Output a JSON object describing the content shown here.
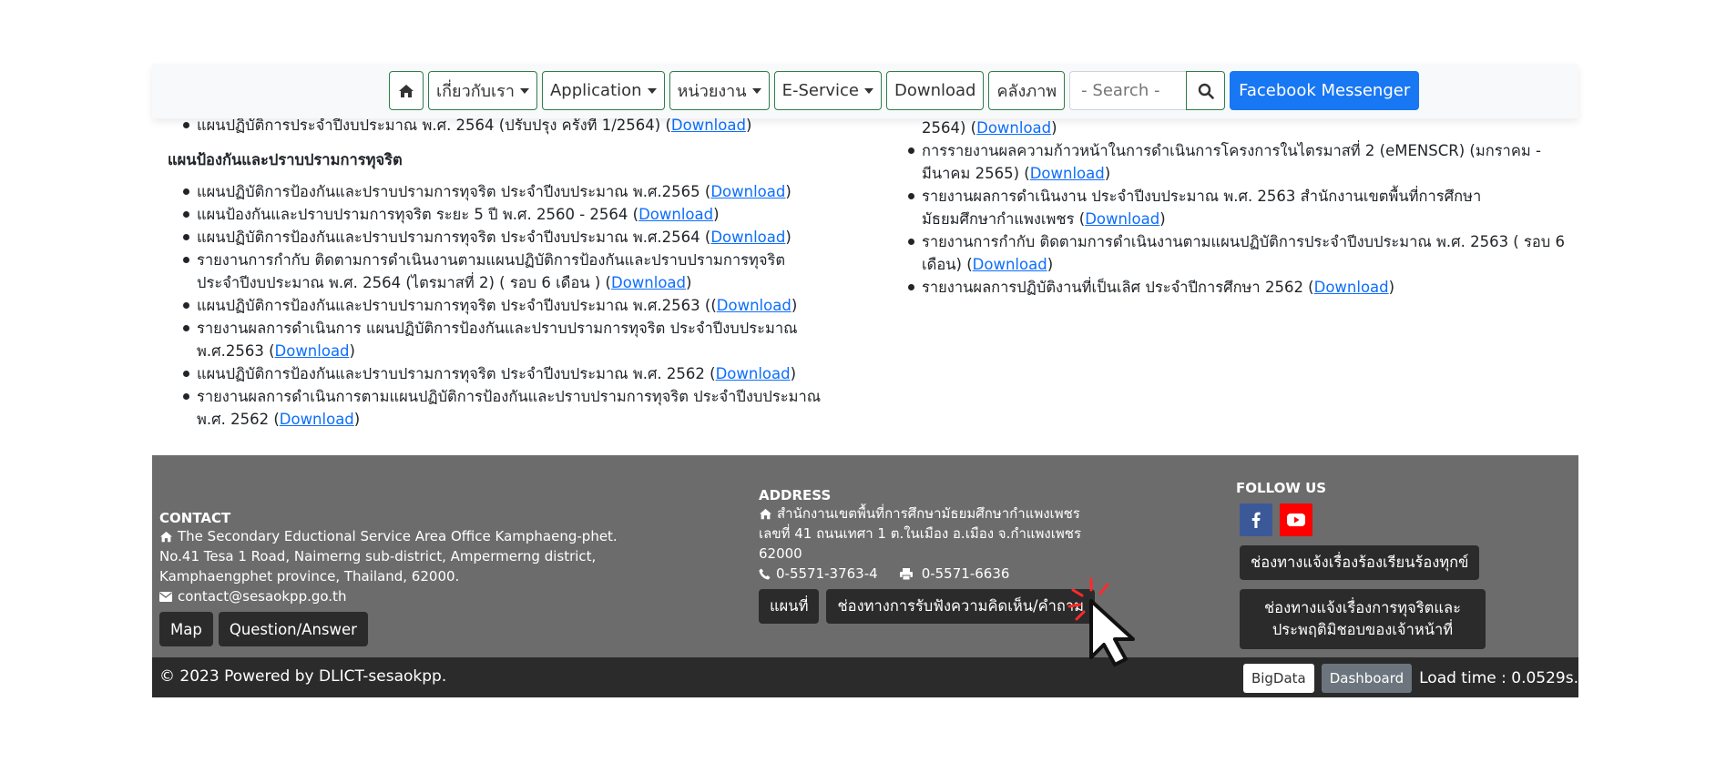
{
  "nav": {
    "about": "เกี่ยวกับเรา",
    "application": "Application",
    "units": "หน่วยงาน",
    "eservice": "E-Service",
    "download": "Download",
    "gallery": "คลังภาพ",
    "search_placeholder": "- Search -",
    "facebook_messenger": "Facebook Messenger"
  },
  "left": {
    "top_item": {
      "text": "แผนปฏิบัติการประจำปีงบประมาณ พ.ศ. 2564 (ปรับปรุง ครั้งที่ 1/2564) (",
      "link": "Download",
      "tail": ")"
    },
    "section_title": "แผนป้องกันและปราบปรามการทุจริต",
    "items": [
      {
        "text": "แผนปฏิบัติการป้องกันและปราบปรามการทุจริต ประจำปีงบประมาณ พ.ศ.2565 (",
        "link": "Download",
        "tail": ")"
      },
      {
        "text": "แผนป้องกันและปราบปรามการทุจริต ระยะ 5 ปี พ.ศ. 2560 - 2564 (",
        "link": "Download",
        "tail": ")"
      },
      {
        "text": "แผนปฏิบัติการป้องกันและปราบปรามการทุจริต ประจำปีงบประมาณ พ.ศ.2564 (",
        "link": "Download",
        "tail": ")"
      },
      {
        "text": "รายงานการกำกับ ติดตามการดำเนินงานตามแผนปฏิบัติการป้องกันและปราบปรามการทุจริต ประจำปีงบประมาณ พ.ศ. 2564 (ไตรมาสที่ 2) ( รอบ 6 เดือน ) (",
        "link": "Download",
        "tail": ")"
      },
      {
        "text": "แผนปฏิบัติการป้องกันและปราบปรามการทุจริต ประจำปีงบประมาณ พ.ศ.2563 ((",
        "link": "Download",
        "tail": ")"
      },
      {
        "text": "รายงานผลการดำเนินการ แผนปฏิบัติการป้องกันและปราบปรามการทุจริต ประจำปีงบประมาณ พ.ศ.2563 (",
        "link": "Download",
        "tail": ")"
      },
      {
        "text": "แผนปฏิบัติการป้องกันและปราบปรามการทุจริต ประจำปีงบประมาณ พ.ศ. 2562 (",
        "link": "Download",
        "tail": ")"
      },
      {
        "text": "รายงานผลการดำเนินการตามแผนปฏิบัติการป้องกันและปราบปรามการทุจริต ประจำปีงบประมาณ พ.ศ. 2562 (",
        "link": "Download",
        "tail": ")"
      }
    ]
  },
  "right": {
    "top_fragment": {
      "text": "2564) (",
      "link": "Download",
      "tail": ")"
    },
    "items": [
      {
        "text": "การรายงานผลความก้าวหน้าในการดำเนินการโครงการในไตรมาสที่ 2 (eMENSCR) (มกราคม - มีนาคม 2565) (",
        "link": "Download",
        "tail": ")"
      },
      {
        "text": "รายงานผลการดำเนินงาน ประจำปีงบประมาณ พ.ศ. 2563 สำนักงานเขตพื้นที่การศึกษามัธยมศึกษากำแพงเพชร (",
        "link": "Download",
        "tail": ")"
      },
      {
        "text": "รายงานการกำกับ ติดตามการดำเนินงานตามแผนปฏิบัติการประจำปีงบประมาณ พ.ศ. 2563 ( รอบ 6 เดือน) (",
        "link": "Download",
        "tail": ")"
      },
      {
        "text": "รายงานผลการปฏิบัติงานที่เป็นเลิศ ประจำปีการศึกษา 2562 (",
        "link": "Download",
        "tail": ")"
      }
    ]
  },
  "footer": {
    "contact": {
      "title": "CONTACT",
      "org": "The Secondary Eductional Service Area Office Kamphaeng-phet.",
      "address": "No.41 Tesa 1 Road, Naimerng sub-district, Ampermerng district, Kamphaengphet province, Thailand, 62000.",
      "email": "contact@sesaokpp.go.th",
      "map_button": "Map",
      "qa_button": "Question/Answer"
    },
    "address": {
      "title": "ADDRESS",
      "org": "สำนักงานเขตพื้นที่การศึกษามัธยมศึกษากำแพงเพชร",
      "line": "เลขที่ 41 ถนนเทศา 1 ต.ในเมือง อ.เมือง จ.กำแพงเพชร 62000",
      "phone": "0-5571-3763-4",
      "fax": "0-5571-6636",
      "map_button": "แผนที่",
      "feedback_button": "ช่องทางการรับฟังความคิดเห็น/คำถาม"
    },
    "follow": {
      "title": "FOLLOW US",
      "complaint_button": "ช่องทางแจ้งเรื่องร้องเรียนร้องทุกข์",
      "corruption_button": "ช่องทางแจ้งเรื่องการทุจริตและประพฤติมิชอบของเจ้าหน้าที่"
    },
    "copyright": "© 2023 Powered by DLICT-sesaokpp.",
    "bigdata": "BigData",
    "dashboard": "Dashboard",
    "load_time": "Load time : 0.0529s."
  }
}
